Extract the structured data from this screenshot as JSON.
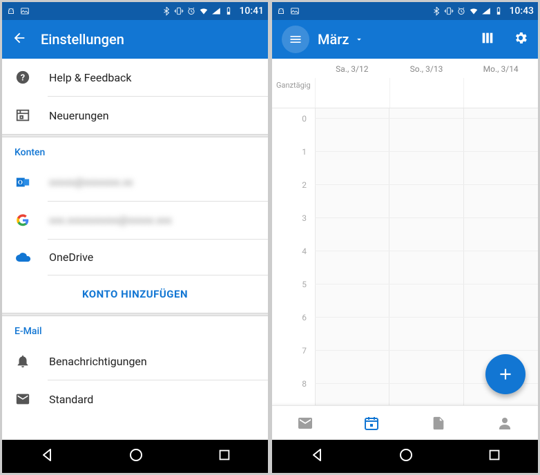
{
  "left": {
    "status_time": "10:41",
    "title": "Einstellungen",
    "items": {
      "help": "Help & Feedback",
      "neuerungen": "Neuerungen"
    },
    "section_accounts": "Konten",
    "accounts": {
      "outlook_blur": "xxxxx@xxxxxxx.xx",
      "google_blur": "xxx.xxxxxxxxxx@xxxxx.xxx",
      "onedrive": "OneDrive"
    },
    "add_account": "KONTO HINZUFÜGEN",
    "section_email": "E-Mail",
    "email_items": {
      "notif": "Benachrichtigungen",
      "standard": "Standard"
    }
  },
  "right": {
    "status_time": "10:43",
    "month": "März",
    "days": [
      "Sa., 3/12",
      "So., 3/13",
      "Mo., 3/14"
    ],
    "allday_label": "Ganztägig",
    "hours": [
      "0",
      "1",
      "2",
      "3",
      "4",
      "5",
      "6",
      "7",
      "8"
    ]
  }
}
